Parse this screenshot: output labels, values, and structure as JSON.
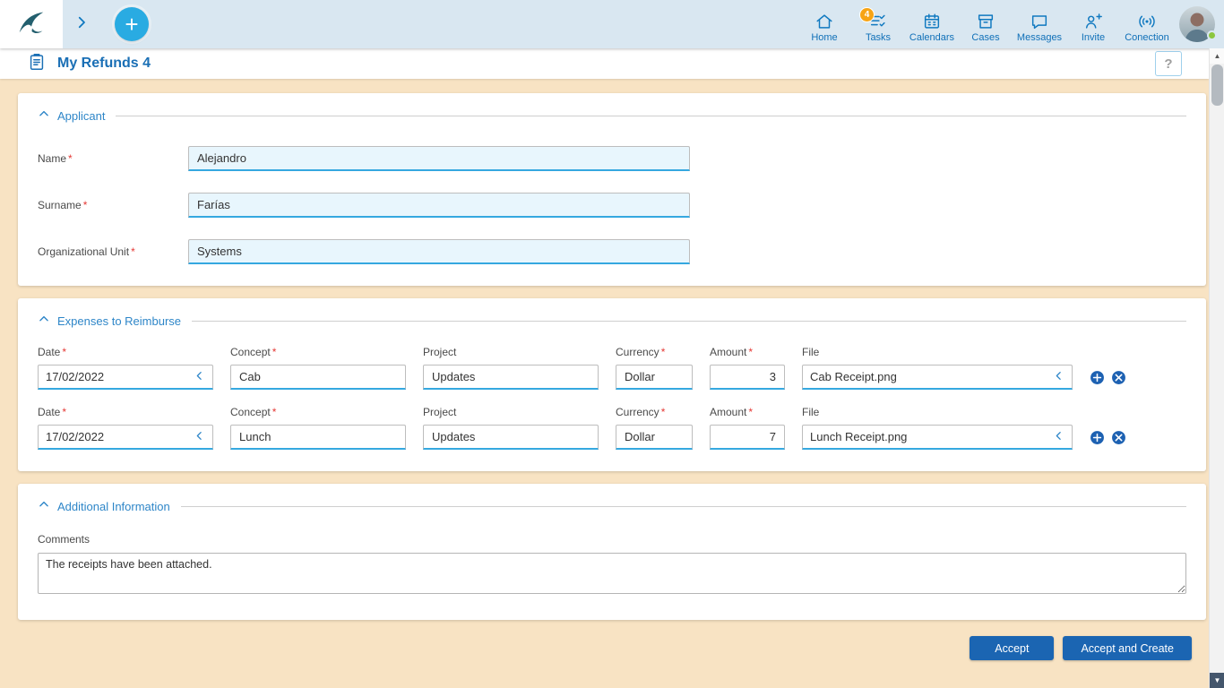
{
  "topbar": {
    "nav_items": [
      {
        "label": "Home"
      },
      {
        "label": "Tasks",
        "badge": "4"
      },
      {
        "label": "Calendars"
      },
      {
        "label": "Cases"
      },
      {
        "label": "Messages"
      },
      {
        "label": "Invite"
      },
      {
        "label": "Conection"
      }
    ]
  },
  "header": {
    "title": "My Refunds 4",
    "help_label": "?"
  },
  "ui": {
    "required_mark": "*"
  },
  "applicant": {
    "section_title": "Applicant",
    "fields": [
      {
        "label": "Name",
        "value": "Alejandro"
      },
      {
        "label": "Surname",
        "value": "Farías"
      },
      {
        "label": "Organizational Unit",
        "value": "Systems"
      }
    ]
  },
  "expenses": {
    "section_title": "Expenses to Reimburse",
    "columns": [
      {
        "label": "Date"
      },
      {
        "label": "Concept"
      },
      {
        "label": "Project"
      },
      {
        "label": "Currency"
      },
      {
        "label": "Amount"
      },
      {
        "label": "File"
      }
    ],
    "rows": [
      {
        "date": "17/02/2022",
        "concept": "Cab",
        "project": "Updates",
        "currency": "Dollar",
        "amount": "3",
        "file": "Cab Receipt.png"
      },
      {
        "date": "17/02/2022",
        "concept": "Lunch",
        "project": "Updates",
        "currency": "Dollar",
        "amount": "7",
        "file": "Lunch Receipt.png"
      }
    ]
  },
  "additional": {
    "section_title": "Additional Information",
    "comments_label": "Comments",
    "comments_value": "The receipts have been attached."
  },
  "footer": {
    "accept_label": "Accept",
    "accept_and_create_label": "Accept and Create"
  },
  "colors": {
    "accent_blue": "#29abe2",
    "nav_blue": "#1070b8",
    "button_blue": "#1b65b2",
    "badge_orange": "#f7a415",
    "page_background": "#f8e3c3"
  }
}
